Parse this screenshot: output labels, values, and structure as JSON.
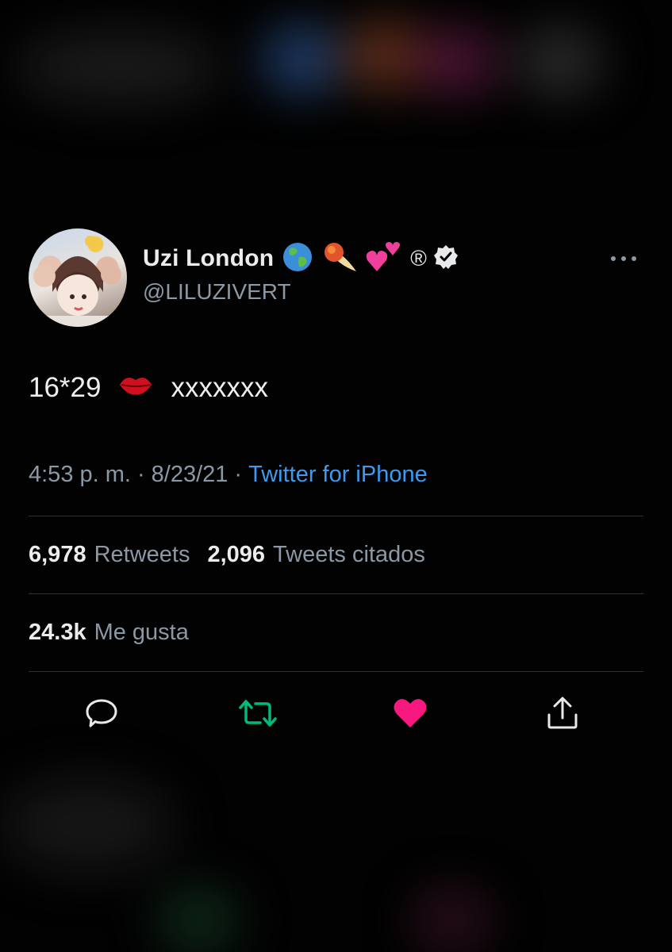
{
  "user": {
    "display_name": "Uzi London",
    "handle": "@LILUZIVERT",
    "name_emojis": [
      "globe-emoji",
      "comet-emoji",
      "two-hearts-emoji"
    ],
    "registered_mark": "®"
  },
  "tweet": {
    "text_prefix": "16*29",
    "text_emoji": "kiss-mark-emoji",
    "text_suffix": "xxxxxxx"
  },
  "meta": {
    "time": "4:53 p. m.",
    "separator": "·",
    "date": "8/23/21",
    "source": "Twitter for iPhone"
  },
  "stats": {
    "retweets_count": "6,978",
    "retweets_label": "Retweets",
    "quotes_count": "2,096",
    "quotes_label": "Tweets citados",
    "likes_count": "24.3k",
    "likes_label": "Me gusta"
  },
  "actions": [
    "reply-icon",
    "retweet-icon",
    "like-icon",
    "share-icon"
  ],
  "colors": {
    "background": "#000000",
    "link": "#3d9aef",
    "retweet_active": "#00ba7c",
    "like_active": "#f91880",
    "secondary_text": "#8b98a5"
  }
}
